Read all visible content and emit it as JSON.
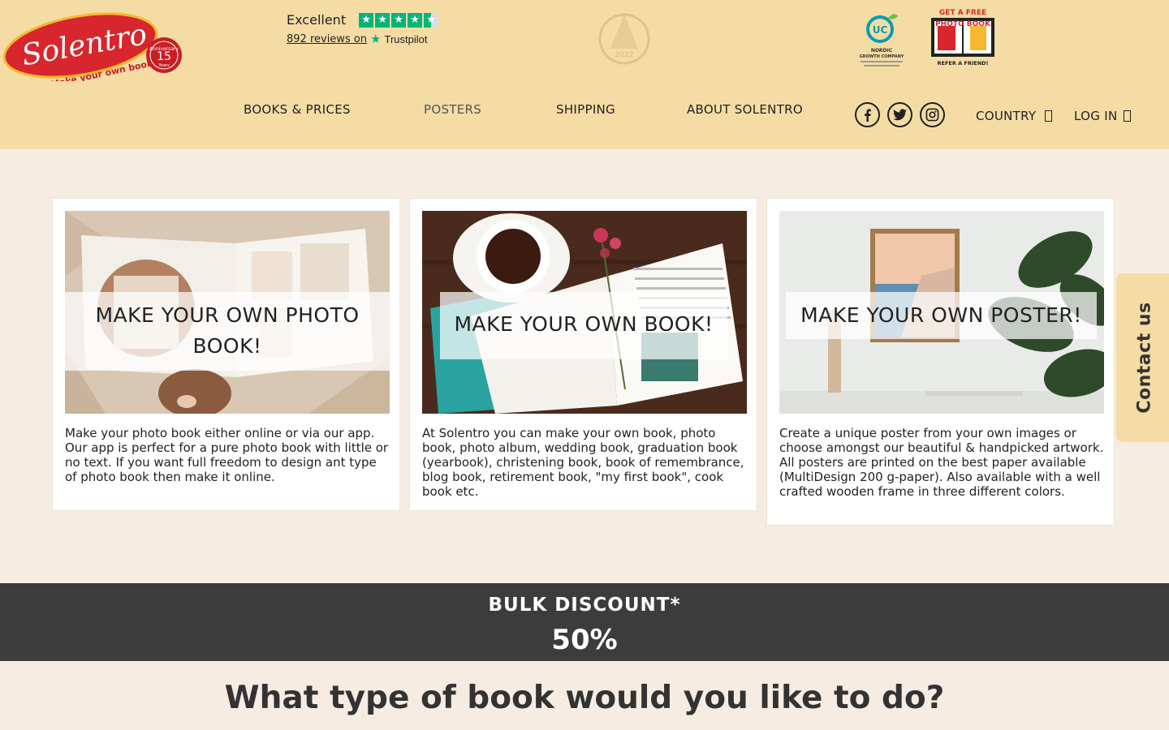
{
  "brand": {
    "name": "Solentro",
    "tagline": "Make your own book",
    "badge_number": "15",
    "badge_top": "Anniversary",
    "badge_bottom": "Years"
  },
  "trustpilot": {
    "rating_label": "Excellent",
    "reviews_link": "892 reviews on",
    "provider": "Trustpilot",
    "stars": 4.5
  },
  "award": {
    "year": "2022"
  },
  "nordic": {
    "title": "NORDIC",
    "subtitle": "GROWTH COMPANY"
  },
  "promo": {
    "line1": "GET A FREE",
    "line2": "PHOTO BOOK",
    "line3": "REFER A FRIEND!"
  },
  "nav": {
    "items": [
      {
        "label": "BOOKS & PRICES"
      },
      {
        "label": "POSTERS"
      },
      {
        "label": "SHIPPING"
      },
      {
        "label": "ABOUT SOLENTRO"
      }
    ],
    "country_label": "COUNTRY",
    "login_label": "LOG IN"
  },
  "social": [
    {
      "icon": "facebook-icon"
    },
    {
      "icon": "twitter-icon"
    },
    {
      "icon": "instagram-icon"
    }
  ],
  "cards": [
    {
      "title": "MAKE YOUR OWN PHOTO BOOK!",
      "text": "Make your photo book either online or via our app. Our app is perfect for a pure photo book with little or no text. If you want full freedom to design ant type of photo book then make it online."
    },
    {
      "title": "MAKE YOUR OWN BOOK!",
      "text": "At Solentro you can make your own book, photo book, photo album, wedding book, graduation book (yearbook), christening book, book of remembrance, blog book, retirement book, \"my first book\", cook book etc."
    },
    {
      "title": "MAKE YOUR OWN POSTER!",
      "text": "Create a unique poster from your own images or choose amongst our beautiful & handpicked artwork. All posters are printed on the best paper available (MultiDesign 200 g-paper). Also available with a well crafted wooden frame in three different colors."
    }
  ],
  "contact": {
    "label": "Contact us"
  },
  "banner": {
    "title": "BULK DISCOUNT*",
    "value": "50%"
  },
  "section": {
    "heading": "What type of book would you like to do?"
  },
  "colors": {
    "header_bg": "#f4dca4",
    "page_bg": "#f7ece2",
    "brand_red": "#d7262d",
    "trustpilot_green": "#00b67a",
    "banner_bg": "#3c3c3c"
  }
}
